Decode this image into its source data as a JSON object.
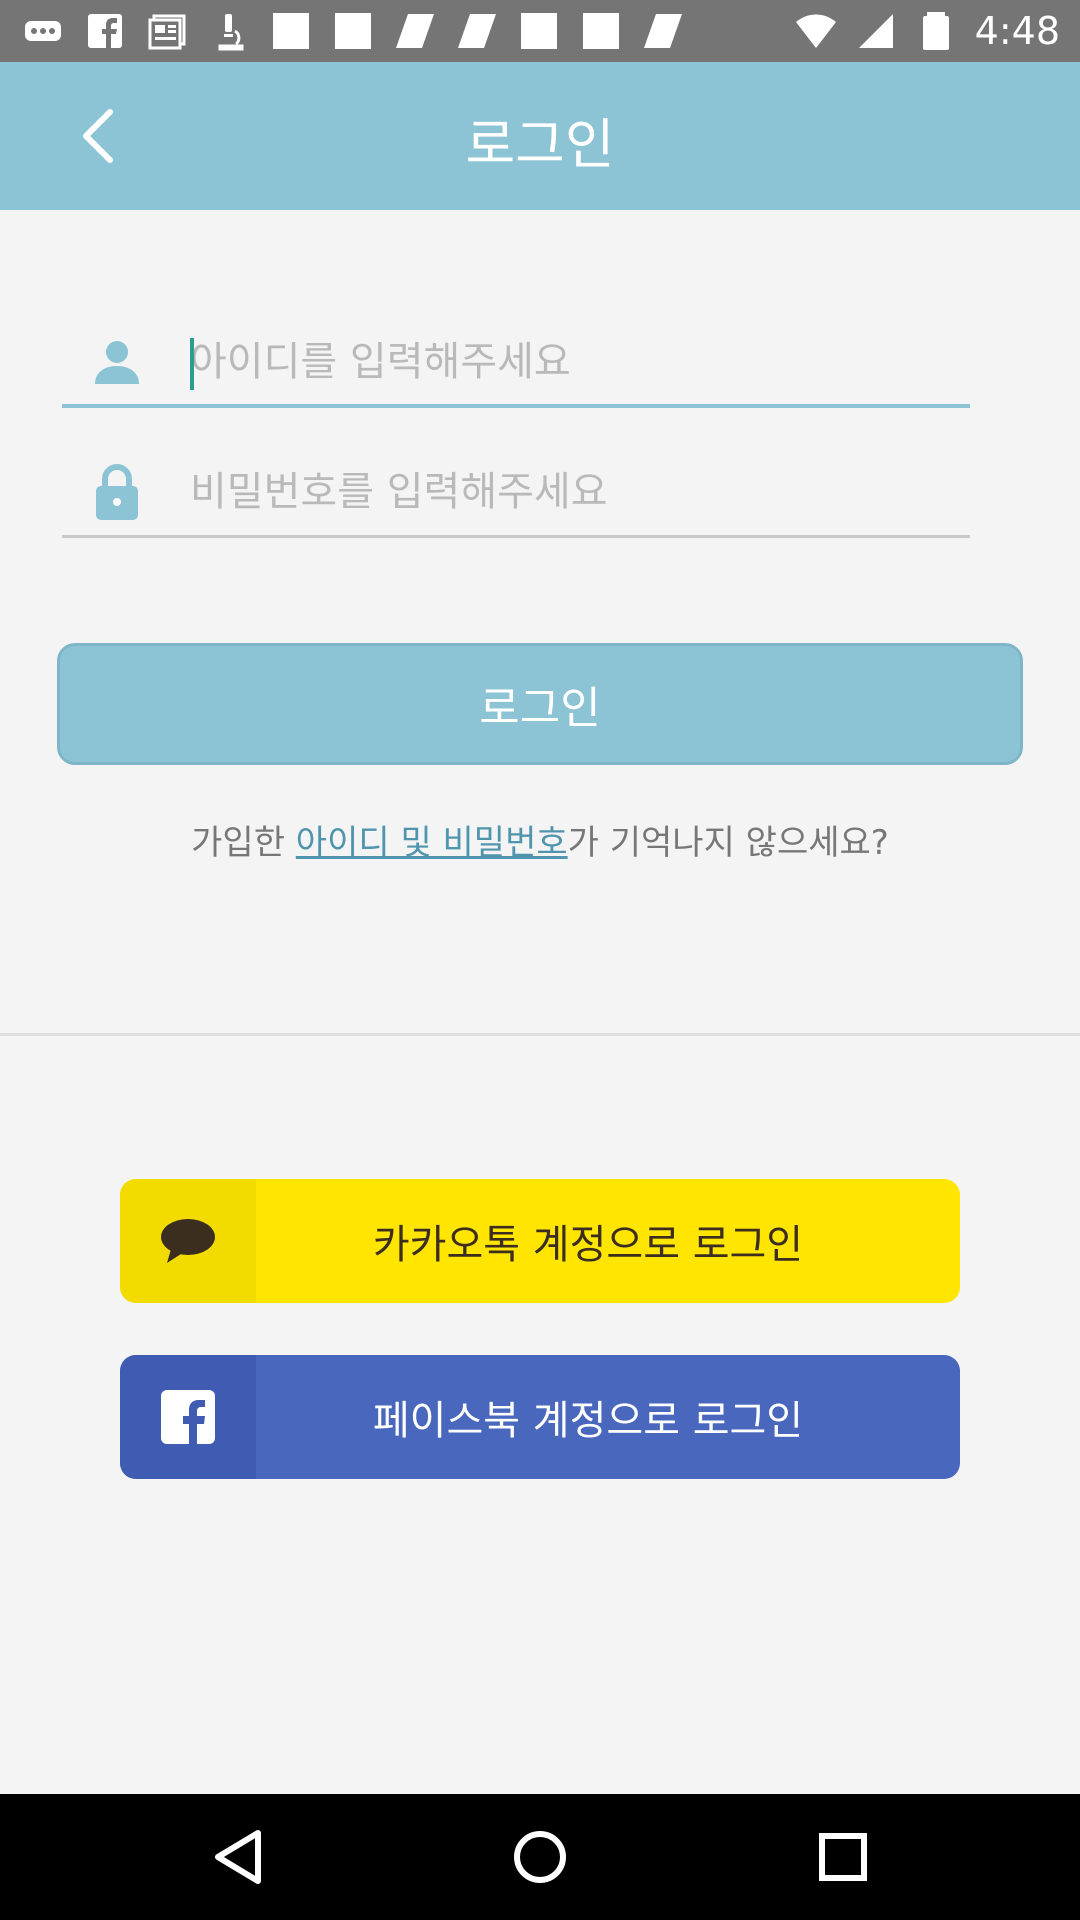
{
  "status_bar": {
    "time": "4:48",
    "icons": [
      "more-icon",
      "facebook-icon",
      "news-icon",
      "microscope-icon",
      "square-icon",
      "square-icon",
      "leaf-icon",
      "leaf-icon",
      "square-icon",
      "square-icon",
      "leaf-icon",
      "wifi-icon",
      "signal-icon",
      "battery-icon"
    ]
  },
  "header": {
    "title": "로그인",
    "back_icon": "chevron-left-icon"
  },
  "form": {
    "id_placeholder": "아이디를 입력해주세요",
    "password_placeholder": "비밀번호를 입력해주세요",
    "id_value": "",
    "password_value": "",
    "login_label": "로그인"
  },
  "forgot": {
    "prefix": "가입한 ",
    "link": "아이디 및 비밀번호",
    "suffix": "가 기억나지 않으세요?"
  },
  "social": {
    "kakao_label": "카카오톡 계정으로 로그인",
    "facebook_label": "페이스북 계정으로 로그인"
  },
  "colors": {
    "accent": "#8cc4d5",
    "kakao": "#ffe500",
    "facebook": "#4a67be",
    "link": "#4f95ad"
  }
}
